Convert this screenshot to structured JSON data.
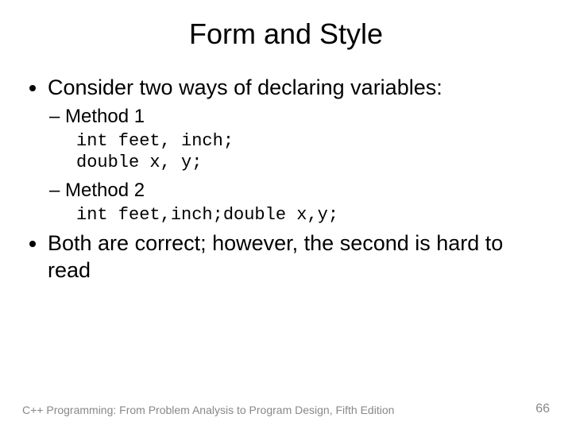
{
  "title": "Form and Style",
  "bullets": {
    "b1": "Consider two ways of declaring variables:",
    "m1_label": "Method 1",
    "m1_code": "int feet, inch;\ndouble x, y;",
    "m2_label": "Method 2",
    "m2_code": "int feet,inch;double x,y;",
    "b2": "Both are correct; however, the second is hard to read"
  },
  "footer": {
    "source": "C++ Programming: From Problem Analysis to Program Design, Fifth Edition",
    "page": "66"
  }
}
